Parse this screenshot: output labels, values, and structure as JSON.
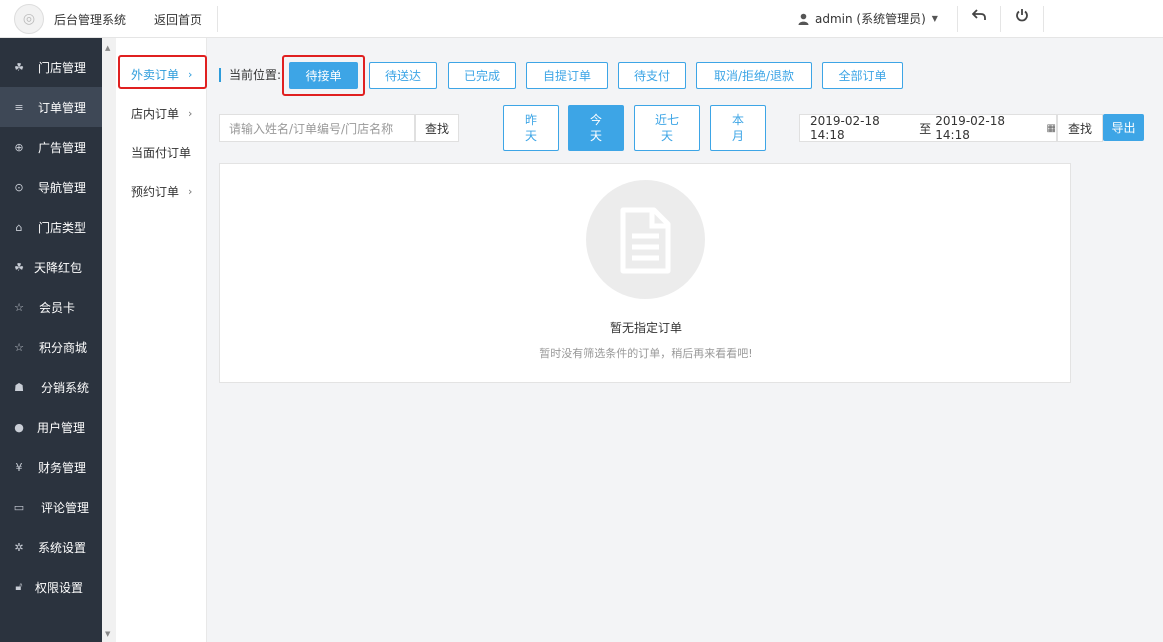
{
  "header": {
    "app_title": "后台管理系统",
    "home_link": "返回首页",
    "user": "admin (系统管理员)"
  },
  "sidebar": {
    "items": [
      {
        "label": "门店管理",
        "icon": "store-icon"
      },
      {
        "label": "订单管理",
        "icon": "list-icon"
      },
      {
        "label": "广告管理",
        "icon": "lifebuoy-icon"
      },
      {
        "label": "导航管理",
        "icon": "compass-icon"
      },
      {
        "label": "门店类型",
        "icon": "bank-icon"
      },
      {
        "label": "天降红包",
        "icon": "cubes-icon"
      },
      {
        "label": "会员卡",
        "icon": "star-icon"
      },
      {
        "label": "积分商城",
        "icon": "star-icon"
      },
      {
        "label": "分销系统",
        "icon": "users-icon"
      },
      {
        "label": "用户管理",
        "icon": "user-icon"
      },
      {
        "label": "财务管理",
        "icon": "yen-icon"
      },
      {
        "label": "评论管理",
        "icon": "money-icon"
      },
      {
        "label": "系统设置",
        "icon": "gear-icon"
      },
      {
        "label": "权限设置",
        "icon": "lock-icon"
      }
    ]
  },
  "subnav": {
    "items": [
      {
        "label": "外卖订单",
        "chevron": "›"
      },
      {
        "label": "店内订单",
        "chevron": "›"
      },
      {
        "label": "当面付订单",
        "chevron": ""
      },
      {
        "label": "预约订单",
        "chevron": "›"
      }
    ]
  },
  "breadcrumb": "当前位置:",
  "status_tabs": [
    "待接单",
    "待送达",
    "已完成",
    "自提订单",
    "待支付",
    "取消/拒绝/退款",
    "全部订单"
  ],
  "search": {
    "placeholder": "请输入姓名/订单编号/门店名称",
    "button": "查找"
  },
  "date_filters": [
    {
      "line1": "昨",
      "line2": "天"
    },
    {
      "line1": "今",
      "line2": "天"
    },
    {
      "line1": "近七",
      "line2": "天"
    },
    {
      "line1": "本",
      "line2": "月"
    }
  ],
  "date_range": {
    "start": "2019-02-18 14:18",
    "separator": "至",
    "end": "2019-02-18 14:18"
  },
  "find_button": "查找",
  "export_button": "导出",
  "empty": {
    "title": "暂无指定订单",
    "description": "暂时没有筛选条件的订单，稍后再来看看吧!"
  },
  "colors": {
    "accent": "#3da5e6",
    "sidebar_bg": "#2b333e",
    "highlight": "#e02020"
  }
}
